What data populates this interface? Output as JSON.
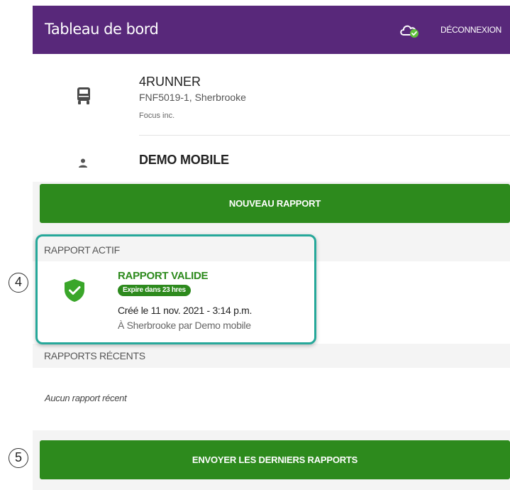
{
  "header": {
    "title": "Tableau de bord",
    "sync_icon": "cloud-check-icon",
    "logout_label": "DÉCONNEXION"
  },
  "vehicle": {
    "icon": "truck-icon",
    "name": "4RUNNER",
    "plate_location": "FNF5019-1, Sherbrooke",
    "company": "Focus inc."
  },
  "user": {
    "icon": "person-icon",
    "name": "DEMO MOBILE"
  },
  "actions": {
    "new_report_label": "NOUVEAU RAPPORT",
    "send_reports_label": "ENVOYER LES DERNIERS RAPPORTS"
  },
  "active_report": {
    "section_label": "RAPPORT ACTIF",
    "icon": "shield-check-icon",
    "status": "RAPPORT VALIDE",
    "expiry_badge": "Expire dans 23 hres",
    "created": "Créé le 11 nov. 2021 - 3:14 p.m.",
    "location": "À Sherbrooke par Demo mobile"
  },
  "recent_reports": {
    "section_label": "RAPPORTS RÉCENTS",
    "empty_text": "Aucun rapport récent"
  },
  "callouts": [
    "4",
    "5"
  ],
  "colors": {
    "header_bg": "#58287a",
    "accent_green": "#2d8a1d",
    "highlight_teal": "#26a89a"
  }
}
